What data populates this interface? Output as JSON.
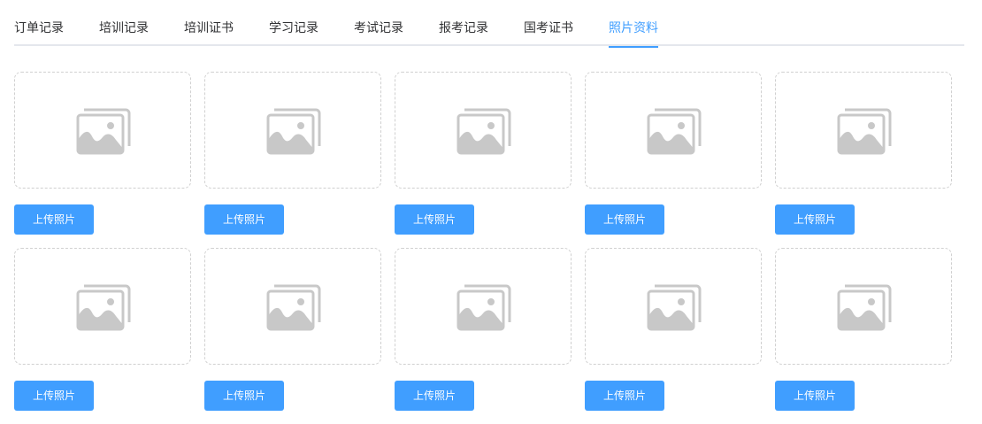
{
  "tabs": [
    {
      "label": "订单记录",
      "active": false
    },
    {
      "label": "培训记录",
      "active": false
    },
    {
      "label": "培训证书",
      "active": false
    },
    {
      "label": "学习记录",
      "active": false
    },
    {
      "label": "考试记录",
      "active": false
    },
    {
      "label": "报考记录",
      "active": false
    },
    {
      "label": "国考证书",
      "active": false
    },
    {
      "label": "照片资料",
      "active": true
    }
  ],
  "photos": {
    "upload_label": "上传照片",
    "placeholder_icon": "image-placeholder-icon",
    "slots": 10
  },
  "colors": {
    "accent": "#409eff",
    "tab_text": "#303133",
    "tab_border": "#e4e7ed",
    "card_border": "#d0d0d0",
    "icon_gray": "#c8c8c8"
  }
}
